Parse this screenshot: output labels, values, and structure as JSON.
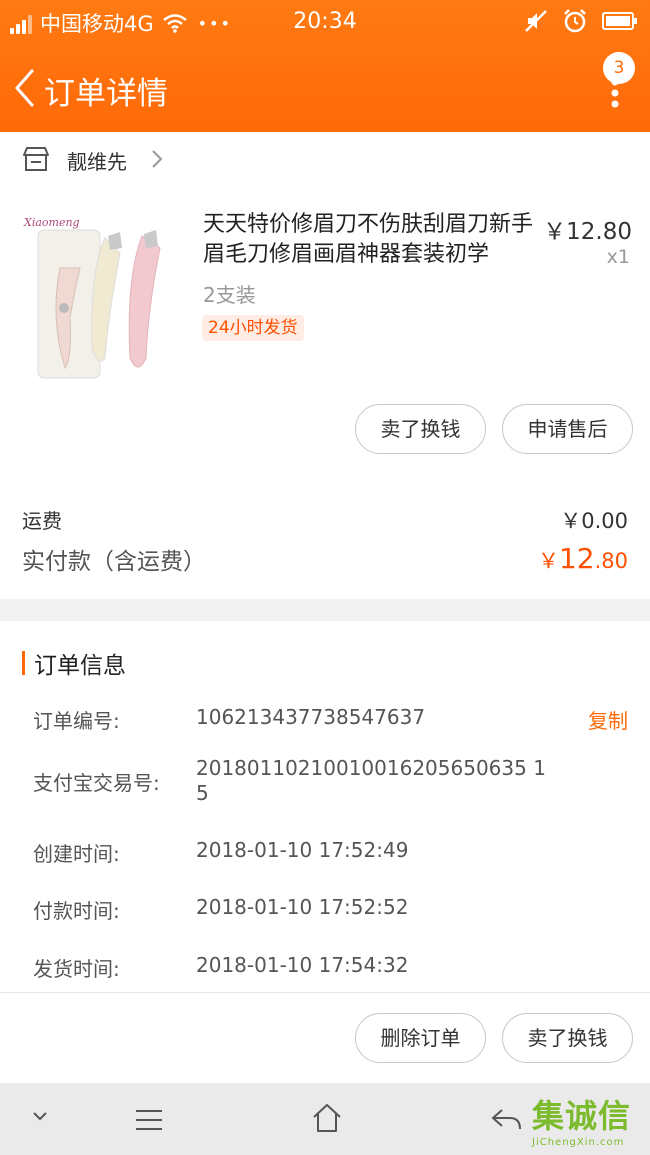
{
  "status_bar": {
    "carrier": "中国移动4G",
    "dots": "•••",
    "time": "20:34"
  },
  "header": {
    "title": "订单详情",
    "badge_count": "3",
    "accent_color": "#ff6a08"
  },
  "shop": {
    "name": "靓维先"
  },
  "product": {
    "title": "天天特价修眉刀不伤肤刮眉刀新手眉毛刀修眉画眉神器套装初学",
    "price": "￥12.80",
    "quantity": "x1",
    "spec": "2支装",
    "tag": "24小时发货",
    "image_logo": "Xiaomeng"
  },
  "product_actions": {
    "exchange_label": "卖了换钱",
    "aftersale_label": "申请售后"
  },
  "fees": {
    "shipping_label": "运费",
    "shipping_value": "￥0.00",
    "total_label": "实付款（含运费）",
    "total_currency": "￥",
    "total_int": "12",
    "total_dec": ".80"
  },
  "order_info": {
    "section_title": "订单信息",
    "copy_label": "复制",
    "rows": [
      {
        "label": "订单编号:",
        "value": "106213437738547637"
      },
      {
        "label": "支付宝交易号:",
        "value": "20180110210010016205650635 15"
      },
      {
        "label": "创建时间:",
        "value": "2018-01-10 17:52:49"
      },
      {
        "label": "付款时间:",
        "value": "2018-01-10 17:52:52"
      },
      {
        "label": "发货时间:",
        "value": "2018-01-10 17:54:32"
      }
    ]
  },
  "bottom_actions": {
    "delete_label": "删除订单",
    "exchange_label": "卖了换钱"
  },
  "watermark": {
    "text": "集诚信",
    "subtext": "JiChengXin.com"
  }
}
